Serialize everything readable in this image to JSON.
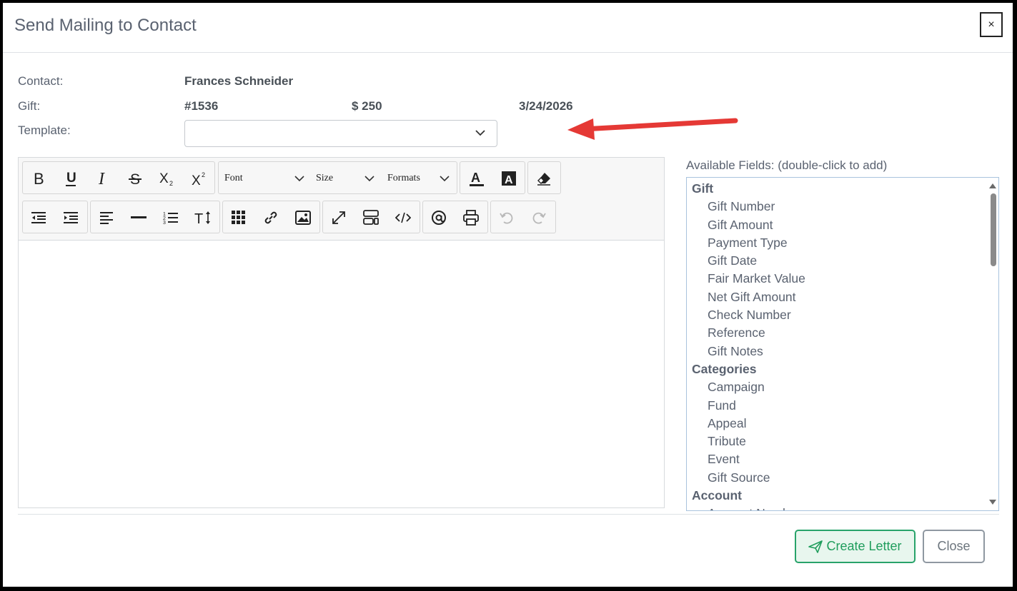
{
  "dialog": {
    "title": "Send Mailing to Contact",
    "close_x": "×"
  },
  "contact": {
    "label": "Contact:",
    "name": "Frances Schneider"
  },
  "gift": {
    "label": "Gift:",
    "number": "#1536",
    "amount": "$ 250",
    "date": "3/24/2026"
  },
  "template": {
    "label": "Template:",
    "value": ""
  },
  "editor": {
    "font_dropdown": "Font",
    "size_dropdown": "Size",
    "formats_dropdown": "Formats",
    "content": ""
  },
  "fields": {
    "label": "Available Fields: (double-click to add)",
    "groups": [
      {
        "name": "Gift",
        "items": [
          "Gift Number",
          "Gift Amount",
          "Payment Type",
          "Gift Date",
          "Fair Market Value",
          "Net Gift Amount",
          "Check Number",
          "Reference",
          "Gift Notes"
        ]
      },
      {
        "name": "Categories",
        "items": [
          "Campaign",
          "Fund",
          "Appeal",
          "Tribute",
          "Event",
          "Gift Source"
        ]
      },
      {
        "name": "Account",
        "items": [
          "Account Number"
        ]
      }
    ]
  },
  "buttons": {
    "create_letter": "Create Letter",
    "close": "Close"
  },
  "colors": {
    "create_accent": "#28a36a",
    "annotation_arrow": "#e53935"
  }
}
